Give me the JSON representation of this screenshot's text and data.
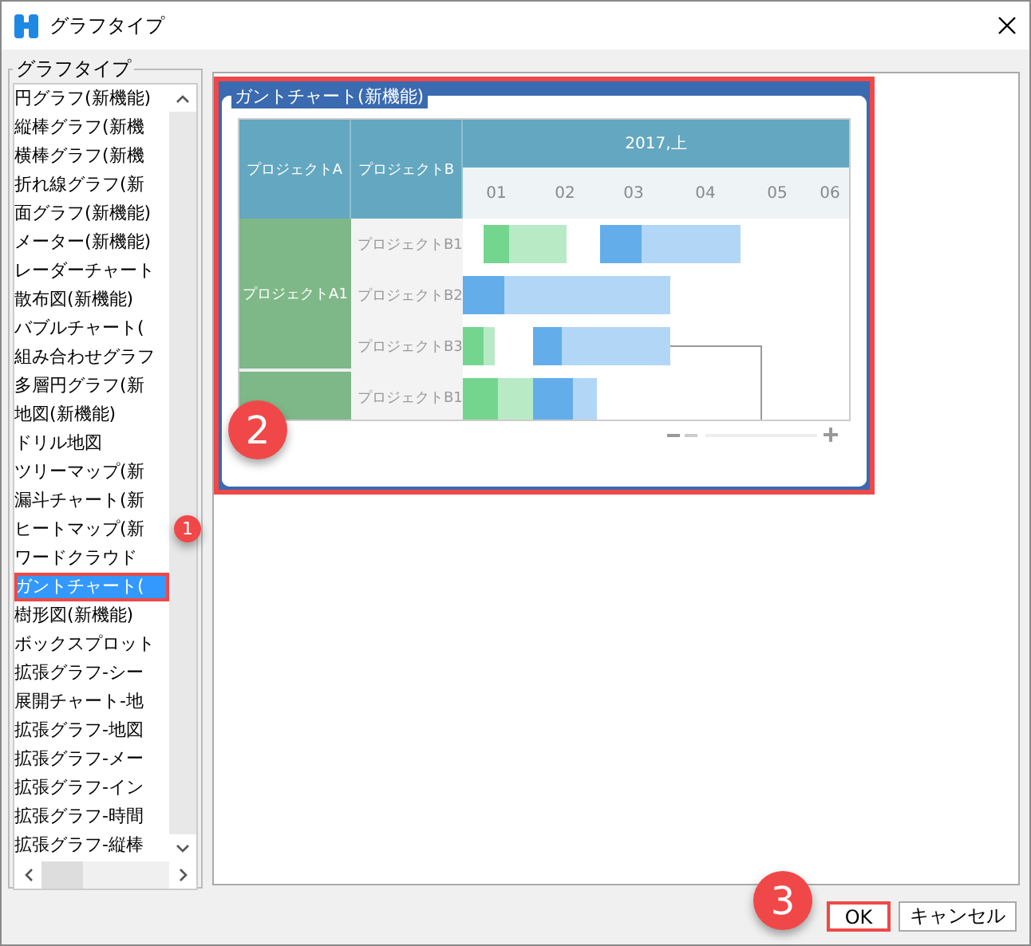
{
  "window": {
    "title": "グラフタイプ"
  },
  "group_label": "グラフタイプ",
  "chart_types": [
    {
      "label": "円グラフ(新機能)",
      "selected": false
    },
    {
      "label": "縦棒グラフ(新機",
      "selected": false
    },
    {
      "label": "横棒グラフ(新機",
      "selected": false
    },
    {
      "label": "折れ線グラフ(新",
      "selected": false
    },
    {
      "label": "面グラフ(新機能)",
      "selected": false
    },
    {
      "label": "メーター(新機能)",
      "selected": false
    },
    {
      "label": "レーダーチャート",
      "selected": false
    },
    {
      "label": "散布図(新機能)",
      "selected": false
    },
    {
      "label": "バブルチャート(",
      "selected": false
    },
    {
      "label": "組み合わせグラフ",
      "selected": false
    },
    {
      "label": "多層円グラフ(新",
      "selected": false
    },
    {
      "label": "地図(新機能)",
      "selected": false
    },
    {
      "label": "ドリル地図",
      "selected": false
    },
    {
      "label": "ツリーマップ(新",
      "selected": false
    },
    {
      "label": "漏斗チャート(新",
      "selected": false
    },
    {
      "label": "ヒートマップ(新",
      "selected": false
    },
    {
      "label": "ワードクラウド",
      "selected": false
    },
    {
      "label": "ガントチャート(",
      "selected": true
    },
    {
      "label": "樹形図(新機能)",
      "selected": false
    },
    {
      "label": "ボックスプロット",
      "selected": false
    },
    {
      "label": "拡張グラフ-シー",
      "selected": false
    },
    {
      "label": "展開チャート-地",
      "selected": false
    },
    {
      "label": "拡張グラフ-地図",
      "selected": false
    },
    {
      "label": "拡張グラフ-メー",
      "selected": false
    },
    {
      "label": "拡張グラフ-イン",
      "selected": false
    },
    {
      "label": "拡張グラフ-時間",
      "selected": false
    },
    {
      "label": "拡張グラフ-縦棒",
      "selected": false
    }
  ],
  "preview": {
    "title": "ガントチャート(新機能)",
    "highlighted": true,
    "gantt": {
      "column_1": "プロジェクトA",
      "column_2": "プロジェクトB",
      "period": "2017,上",
      "months": [
        "01",
        "02",
        "03",
        "04",
        "05",
        "06"
      ],
      "groups": [
        {
          "name": "プロジェクトA1",
          "items": [
            "プロジェクトB1",
            "プロジェクトB2",
            "プロジェクトB3"
          ]
        },
        {
          "items": [
            "プロジェクトB1"
          ]
        }
      ]
    }
  },
  "buttons": [
    {
      "label": "OK",
      "highlighted": true
    },
    {
      "label": "キャンセル",
      "highlighted": false
    }
  ],
  "callouts": [
    "1",
    "2",
    "3"
  ]
}
